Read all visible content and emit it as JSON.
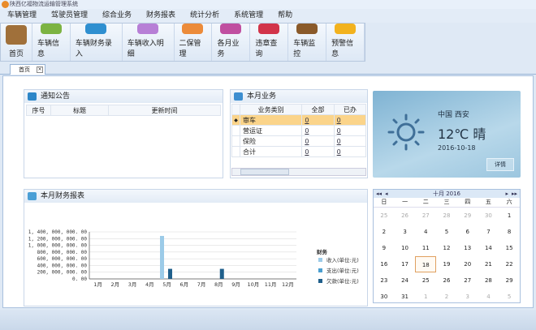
{
  "app": {
    "title": "陕西亿福物流运输管理系统"
  },
  "menu": [
    "车辆管理",
    "驾驶员管理",
    "综合业务",
    "财务报表",
    "统计分析",
    "系统管理",
    "帮助"
  ],
  "toolbar": [
    {
      "label": "首页",
      "icon": "home-icon",
      "color": "#a0703a"
    },
    {
      "label": "车辆信息",
      "icon": "vehicle-info-icon",
      "color": "#7cb342"
    },
    {
      "label": "车辆财务录入",
      "icon": "finance-entry-icon",
      "color": "#2f8fd0"
    },
    {
      "label": "车辆收入明细",
      "icon": "income-detail-icon",
      "color": "#b77fd6"
    },
    {
      "label": "二保管理",
      "icon": "maintenance-icon",
      "color": "#ec8b3a"
    },
    {
      "label": "各月业务",
      "icon": "monthly-business-icon",
      "color": "#c04fa0"
    },
    {
      "label": "违章查询",
      "icon": "violation-search-icon",
      "color": "#d2344a"
    },
    {
      "label": "车辆监控",
      "icon": "vehicle-monitor-icon",
      "color": "#8a5a2a"
    },
    {
      "label": "预警信息",
      "icon": "alert-bell-icon",
      "color": "#f2b21e"
    }
  ],
  "tab": {
    "label": "首页"
  },
  "notice": {
    "title": "通知公告",
    "columns": [
      "序号",
      "标题",
      "更新时间"
    ]
  },
  "business": {
    "title": "本月业务",
    "columns": [
      "业务类别",
      "全部",
      "已办"
    ],
    "rows": [
      {
        "type": "审车",
        "all": "0",
        "done": "0"
      },
      {
        "type": "营运证",
        "all": "0",
        "done": "0"
      },
      {
        "type": "保险",
        "all": "0",
        "done": "0"
      },
      {
        "type": "合计",
        "all": "0",
        "done": "0"
      }
    ]
  },
  "weather": {
    "location": "中国 西安",
    "temp": "12℃ 晴",
    "date": "2016-10-18",
    "details": "详情"
  },
  "finance": {
    "title": "本月财务报表"
  },
  "chart_data": {
    "type": "bar",
    "categories": [
      "1月",
      "2月",
      "3月",
      "4月",
      "5月",
      "6月",
      "7月",
      "8月",
      "9月",
      "10月",
      "11月",
      "12月"
    ],
    "series": [
      {
        "name": "收入(单位:元)",
        "color": "#9ccbe8",
        "values": [
          0,
          0,
          0,
          0,
          1280000000,
          0,
          0,
          0,
          0,
          0,
          0,
          0
        ]
      },
      {
        "name": "支出(单位:元)",
        "color": "#4b9fd0",
        "values": [
          0,
          0,
          0,
          0,
          0,
          0,
          0,
          0,
          0,
          0,
          0,
          0
        ]
      },
      {
        "name": "欠款(单位:元)",
        "color": "#1f5f8b",
        "values": [
          0,
          0,
          0,
          0,
          300000000,
          0,
          0,
          300000000,
          0,
          0,
          0,
          0
        ]
      }
    ],
    "yticks": [
      "1, 400, 000, 000. 00",
      "1, 200, 000, 000. 00",
      "1, 000, 000, 000. 00",
      "800, 000, 000. 00",
      "600, 000, 000. 00",
      "400, 000, 000. 00",
      "200, 000, 000. 00",
      "0. 00"
    ],
    "ylim": [
      0,
      1400000000
    ],
    "legend_title": "财务",
    "legend_position": "right"
  },
  "calendar": {
    "title": "十月 2016",
    "weekdays": [
      "日",
      "一",
      "二",
      "三",
      "四",
      "五",
      "六"
    ],
    "days": [
      "25",
      "26",
      "27",
      "28",
      "29",
      "30",
      "1",
      "2",
      "3",
      "4",
      "5",
      "6",
      "7",
      "8",
      "9",
      "10",
      "11",
      "12",
      "13",
      "14",
      "15",
      "16",
      "17",
      "18",
      "19",
      "20",
      "21",
      "22",
      "23",
      "24",
      "25",
      "26",
      "27",
      "28",
      "29",
      "30",
      "31",
      "1",
      "2",
      "3",
      "4",
      "5"
    ],
    "selected": "18"
  }
}
